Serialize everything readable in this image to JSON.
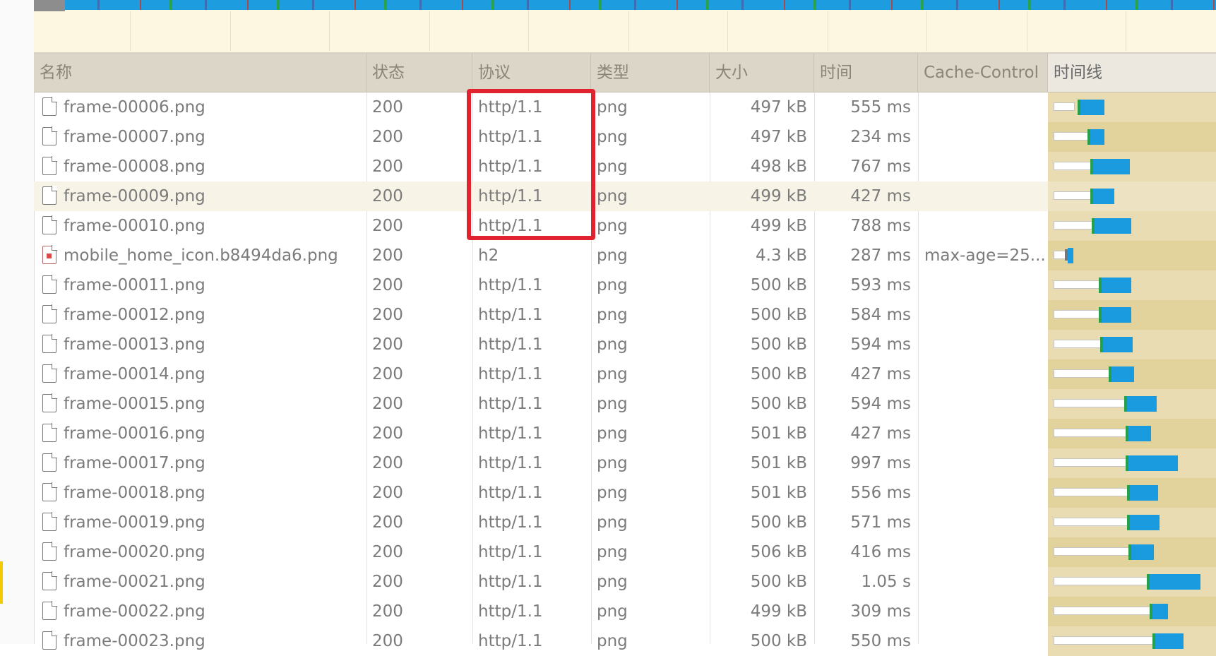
{
  "columns": {
    "name": "名称",
    "status": "状态",
    "protocol": "协议",
    "type": "类型",
    "size": "大小",
    "time": "时间",
    "cache": "Cache-Control",
    "timeline": "时间线"
  },
  "rows": [
    {
      "icon": "file-icon",
      "name": "frame-00006.png",
      "status": "200",
      "protocol": "http/1.1",
      "type": "png",
      "size": "497 kB",
      "time": "555 ms",
      "cache": "",
      "timeline": {
        "wait": [
          8,
          38
        ],
        "blue": [
          46,
          80
        ]
      }
    },
    {
      "icon": "file-icon",
      "name": "frame-00007.png",
      "status": "200",
      "protocol": "http/1.1",
      "type": "png",
      "size": "497 kB",
      "time": "234 ms",
      "cache": "",
      "timeline": {
        "wait": [
          8,
          58
        ],
        "blue": [
          60,
          80
        ]
      }
    },
    {
      "icon": "file-icon",
      "name": "frame-00008.png",
      "status": "200",
      "protocol": "http/1.1",
      "type": "png",
      "size": "498 kB",
      "time": "767 ms",
      "cache": "",
      "timeline": {
        "wait": [
          8,
          62
        ],
        "blue": [
          64,
          116
        ]
      }
    },
    {
      "icon": "file-icon",
      "name": "frame-00009.png",
      "status": "200",
      "protocol": "http/1.1",
      "type": "png",
      "size": "499 kB",
      "time": "427 ms",
      "cache": "",
      "timeline": {
        "wait": [
          8,
          62
        ],
        "blue": [
          64,
          94
        ]
      },
      "selected": true
    },
    {
      "icon": "file-icon",
      "name": "frame-00010.png",
      "status": "200",
      "protocol": "http/1.1",
      "type": "png",
      "size": "499 kB",
      "time": "788 ms",
      "cache": "",
      "timeline": {
        "wait": [
          8,
          64
        ],
        "blue": [
          66,
          118
        ]
      }
    },
    {
      "icon": "image-icon",
      "name": "mobile_home_icon.b8494da6.png",
      "status": "200",
      "protocol": "h2",
      "type": "png",
      "size": "4.3 kB",
      "time": "287 ms",
      "cache": "max-age=25...",
      "timeline": {
        "wait": [
          8,
          26
        ],
        "blue": [
          28,
          36
        ]
      }
    },
    {
      "icon": "file-icon",
      "name": "frame-00011.png",
      "status": "200",
      "protocol": "http/1.1",
      "type": "png",
      "size": "500 kB",
      "time": "593 ms",
      "cache": "",
      "timeline": {
        "wait": [
          8,
          74
        ],
        "blue": [
          76,
          118
        ]
      }
    },
    {
      "icon": "file-icon",
      "name": "frame-00012.png",
      "status": "200",
      "protocol": "http/1.1",
      "type": "png",
      "size": "500 kB",
      "time": "584 ms",
      "cache": "",
      "timeline": {
        "wait": [
          8,
          74
        ],
        "blue": [
          76,
          118
        ]
      }
    },
    {
      "icon": "file-icon",
      "name": "frame-00013.png",
      "status": "200",
      "protocol": "http/1.1",
      "type": "png",
      "size": "500 kB",
      "time": "594 ms",
      "cache": "",
      "timeline": {
        "wait": [
          8,
          76
        ],
        "blue": [
          78,
          120
        ]
      }
    },
    {
      "icon": "file-icon",
      "name": "frame-00014.png",
      "status": "200",
      "protocol": "http/1.1",
      "type": "png",
      "size": "500 kB",
      "time": "427 ms",
      "cache": "",
      "timeline": {
        "wait": [
          8,
          88
        ],
        "blue": [
          90,
          122
        ]
      }
    },
    {
      "icon": "file-icon",
      "name": "frame-00015.png",
      "status": "200",
      "protocol": "http/1.1",
      "type": "png",
      "size": "500 kB",
      "time": "594 ms",
      "cache": "",
      "timeline": {
        "wait": [
          8,
          110
        ],
        "blue": [
          112,
          154
        ]
      }
    },
    {
      "icon": "file-icon",
      "name": "frame-00016.png",
      "status": "200",
      "protocol": "http/1.1",
      "type": "png",
      "size": "501 kB",
      "time": "427 ms",
      "cache": "",
      "timeline": {
        "wait": [
          8,
          112
        ],
        "blue": [
          114,
          146
        ]
      }
    },
    {
      "icon": "file-icon",
      "name": "frame-00017.png",
      "status": "200",
      "protocol": "http/1.1",
      "type": "png",
      "size": "501 kB",
      "time": "997 ms",
      "cache": "",
      "timeline": {
        "wait": [
          8,
          112
        ],
        "blue": [
          114,
          184
        ]
      }
    },
    {
      "icon": "file-icon",
      "name": "frame-00018.png",
      "status": "200",
      "protocol": "http/1.1",
      "type": "png",
      "size": "501 kB",
      "time": "556 ms",
      "cache": "",
      "timeline": {
        "wait": [
          8,
          114
        ],
        "blue": [
          116,
          156
        ]
      }
    },
    {
      "icon": "file-icon",
      "name": "frame-00019.png",
      "status": "200",
      "protocol": "http/1.1",
      "type": "png",
      "size": "500 kB",
      "time": "571 ms",
      "cache": "",
      "timeline": {
        "wait": [
          8,
          114
        ],
        "blue": [
          116,
          158
        ]
      }
    },
    {
      "icon": "file-icon",
      "name": "frame-00020.png",
      "status": "200",
      "protocol": "http/1.1",
      "type": "png",
      "size": "506 kB",
      "time": "416 ms",
      "cache": "",
      "timeline": {
        "wait": [
          8,
          116
        ],
        "blue": [
          118,
          150
        ]
      }
    },
    {
      "icon": "file-icon",
      "name": "frame-00021.png",
      "status": "200",
      "protocol": "http/1.1",
      "type": "png",
      "size": "500 kB",
      "time": "1.05 s",
      "cache": "",
      "timeline": {
        "wait": [
          8,
          142
        ],
        "blue": [
          144,
          216
        ]
      }
    },
    {
      "icon": "file-icon",
      "name": "frame-00022.png",
      "status": "200",
      "protocol": "http/1.1",
      "type": "png",
      "size": "499 kB",
      "time": "309 ms",
      "cache": "",
      "timeline": {
        "wait": [
          8,
          146
        ],
        "blue": [
          148,
          170
        ]
      }
    },
    {
      "icon": "file-icon",
      "name": "frame-00023.png",
      "status": "200",
      "protocol": "http/1.1",
      "type": "png",
      "size": "500 kB",
      "time": "550 ms",
      "cache": "",
      "timeline": {
        "wait": [
          8,
          150
        ],
        "blue": [
          152,
          192
        ]
      }
    }
  ],
  "colors": {
    "accent_highlight": "#e1232f",
    "timeline_blue": "#1a9be0",
    "timeline_green": "#27a048",
    "header_bg": "#dcd6c8"
  }
}
